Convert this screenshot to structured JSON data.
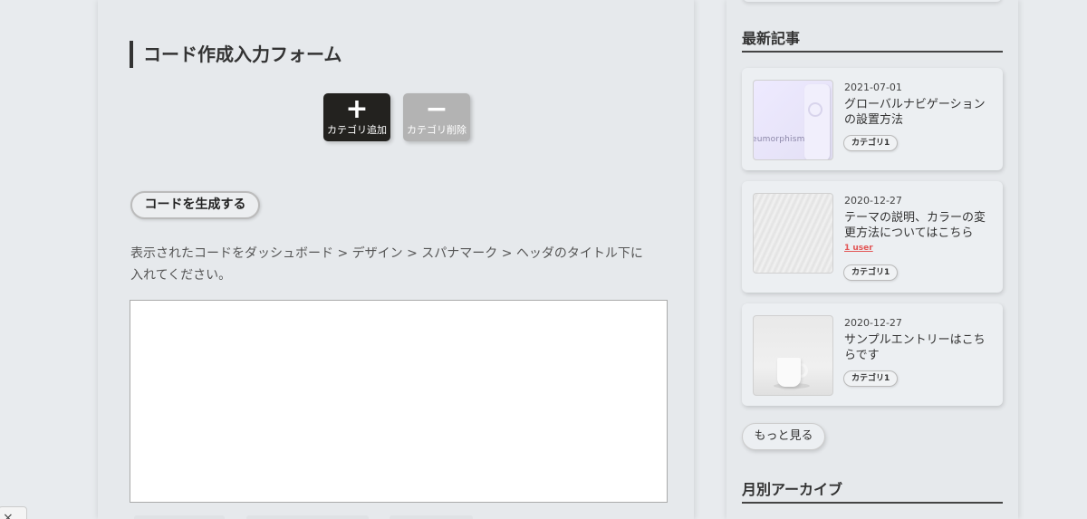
{
  "form": {
    "title": "コード作成入力フォーム",
    "add_category": {
      "symbol": "+",
      "label": "カテゴリ追加"
    },
    "remove_category": {
      "symbol": "−",
      "label": "カテゴリ削除"
    },
    "generate_button": "コードを生成する",
    "instruction_line1": "表示されたコードをダッシュボード > デザイン >  スパナマーク > ヘッダのタイトル下に",
    "instruction_line2": "入れてください。",
    "code_output": ""
  },
  "sidebar": {
    "recent_title": "最新記事",
    "articles": [
      {
        "date": "2021-07-01",
        "title": "グローバルナビゲーションの設置方法",
        "category": "カテゴリ1",
        "thumbnail": "neumorphism",
        "thumb_caption": "eumorphism"
      },
      {
        "date": "2020-12-27",
        "title": "テーマの説明、カラーの変更方法についてはこちら",
        "user_badge": "1 user",
        "category": "カテゴリ1",
        "thumbnail": "abstract-wave"
      },
      {
        "date": "2020-12-27",
        "title": "サンプルエントリーはこちらです",
        "category": "カテゴリ1",
        "thumbnail": "white-cup"
      }
    ],
    "more_button": "もっと見る",
    "archive_title": "月別アーカイブ"
  },
  "corner": {
    "close_glyph": "×"
  },
  "colors": {
    "background": "#e8ebee",
    "add_button": "#23221f",
    "remove_button": "#b3b3b3",
    "user_badge": "#e25555"
  }
}
